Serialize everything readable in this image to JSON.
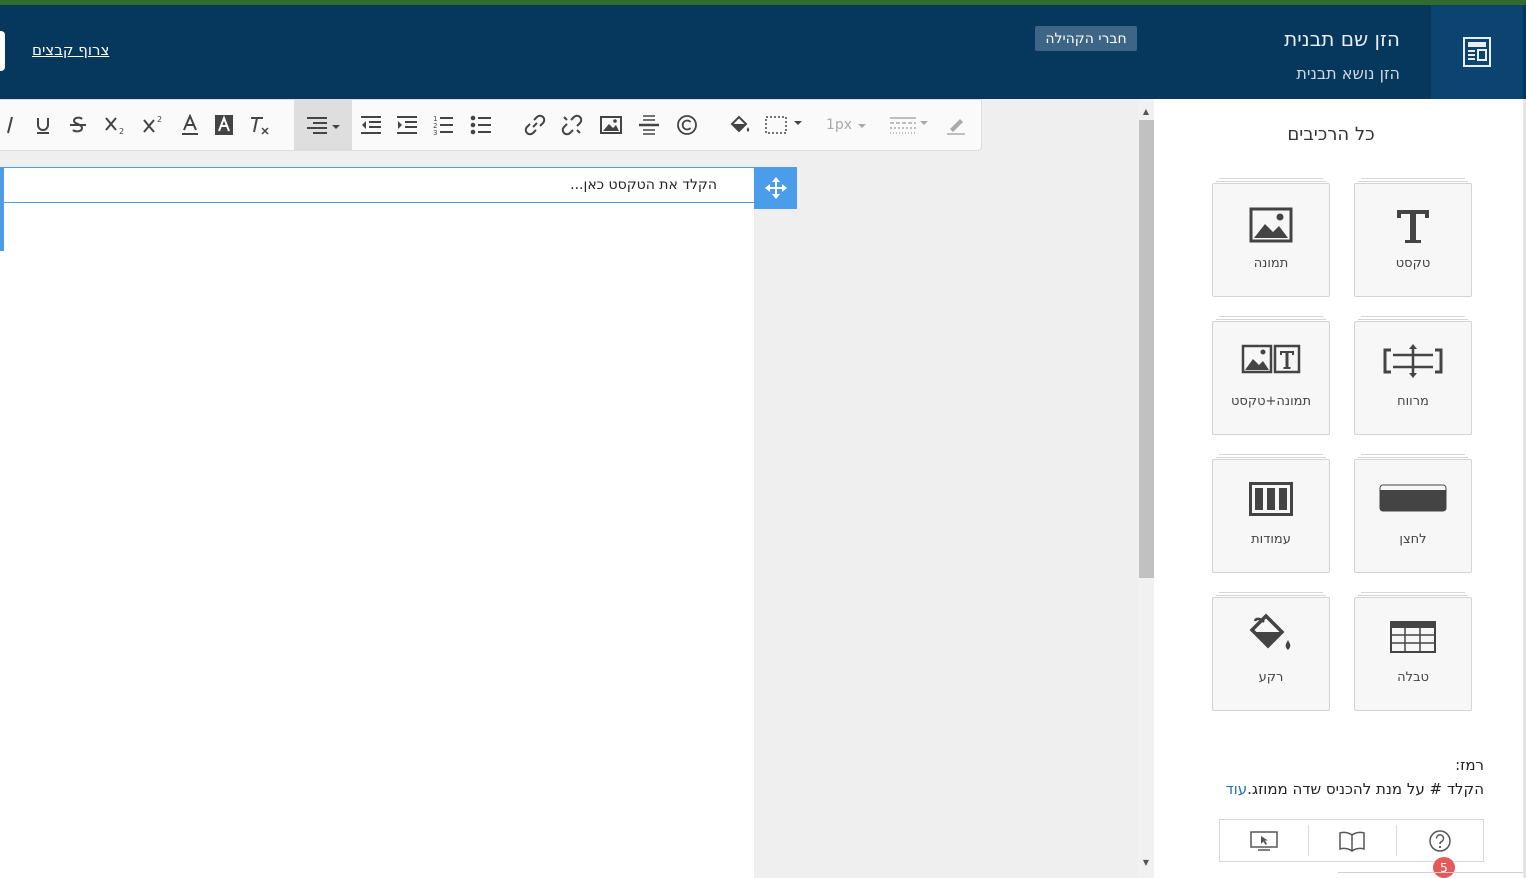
{
  "header": {
    "title": "הזן שם תבנית",
    "subtitle": "הזן נושא תבנית",
    "community_button": "חברי הקהילה",
    "attach_files_link": "צרוף קבצים",
    "background_color": "#06375d"
  },
  "toolbar": {
    "items": [
      "italic-icon",
      "underline-icon",
      "strikethrough-icon",
      "subscript-icon",
      "superscript-icon",
      "font-color-icon",
      "highlight-color-icon",
      "clear-format-icon",
      "align-dropdown-icon",
      "indent-decrease-icon",
      "indent-increase-icon",
      "numbered-list-icon",
      "bullet-list-icon",
      "link-icon",
      "unlink-icon",
      "image-icon",
      "horizontal-rule-icon",
      "copyright-icon",
      "fill-color-icon",
      "border-dropdown-icon",
      "border-style-dropdown-icon",
      "eraser-icon"
    ],
    "border_width_value": "1px"
  },
  "editor": {
    "placeholder": "הקלד את הטקסט כאן...",
    "accent_color": "#4a9de8"
  },
  "panel": {
    "title": "כל הרכיבים",
    "components": [
      {
        "label": "טקסט",
        "icon": "text-icon"
      },
      {
        "label": "תמונה",
        "icon": "image-icon"
      },
      {
        "label": "מרווח",
        "icon": "spacer-icon"
      },
      {
        "label": "תמונה+טקסט",
        "icon": "image-text-icon"
      },
      {
        "label": "לחצן",
        "icon": "button-icon"
      },
      {
        "label": "עמודות",
        "icon": "columns-icon"
      },
      {
        "label": "טבלה",
        "icon": "table-icon"
      },
      {
        "label": "רקע",
        "icon": "background-icon"
      }
    ],
    "hint_label": "רמז:",
    "hint_text": "הקלד # על מנת להכניס שדה ממוזג.",
    "hint_more": "עוד",
    "help_icons": [
      "help-icon",
      "book-icon",
      "video-tutorial-icon"
    ],
    "notification_count": "5"
  }
}
